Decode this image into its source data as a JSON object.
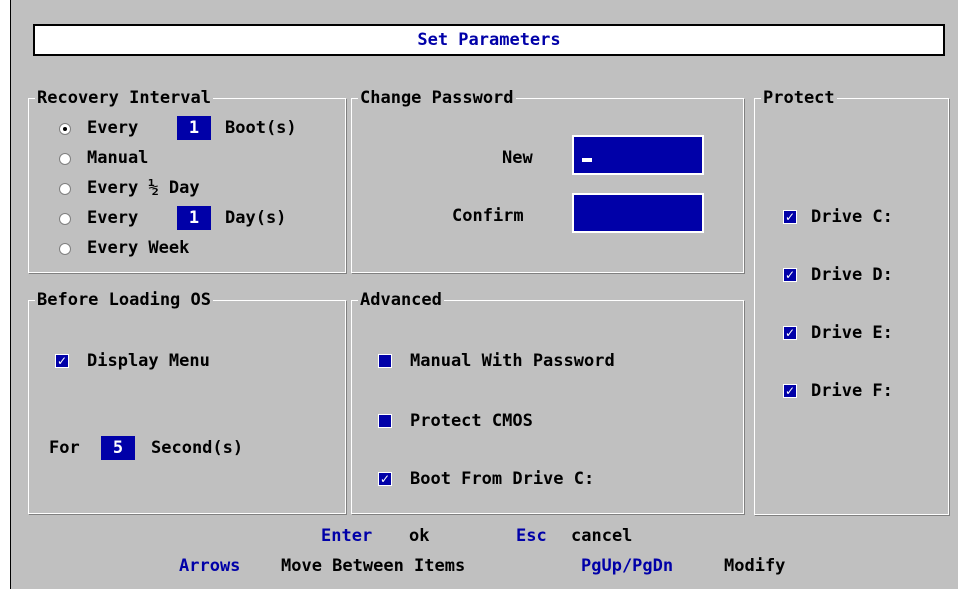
{
  "title": "Set Parameters",
  "recovery": {
    "label": "Recovery Interval",
    "opt1_prefix": "Every",
    "opt1_value": "1",
    "opt1_suffix": "Boot(s)",
    "opt2": "Manual",
    "opt3": "Every ½ Day",
    "opt4_prefix": "Every",
    "opt4_value": "1",
    "opt4_suffix": "Day(s)",
    "opt5": "Every Week",
    "selected": "opt1"
  },
  "password": {
    "label": "Change Password",
    "new_label": "New",
    "confirm_label": "Confirm"
  },
  "protect": {
    "label": "Protect",
    "drives": [
      "Drive C:",
      "Drive D:",
      "Drive E:",
      "Drive F:"
    ],
    "checked": [
      true,
      true,
      true,
      true
    ]
  },
  "before_os": {
    "label": "Before Loading OS",
    "display_menu": "Display Menu",
    "display_menu_checked": true,
    "for_label": "For",
    "seconds_value": "5",
    "seconds_label": "Second(s)"
  },
  "advanced": {
    "label": "Advanced",
    "manual_pw": "Manual With Password",
    "manual_pw_checked": false,
    "protect_cmos": "Protect CMOS",
    "protect_cmos_checked": false,
    "boot_c": "Boot From Drive C:",
    "boot_c_checked": true
  },
  "footer": {
    "enter_key": "Enter",
    "enter_action": "ok",
    "esc_key": "Esc",
    "esc_action": "cancel",
    "arrows_key": "Arrows",
    "arrows_action": "Move Between Items",
    "pg_key": "PgUp/PgDn",
    "pg_action": "Modify"
  },
  "colors": {
    "background": "#c0c0c0",
    "accent": "#0000a8"
  },
  "check_glyph": "✓"
}
